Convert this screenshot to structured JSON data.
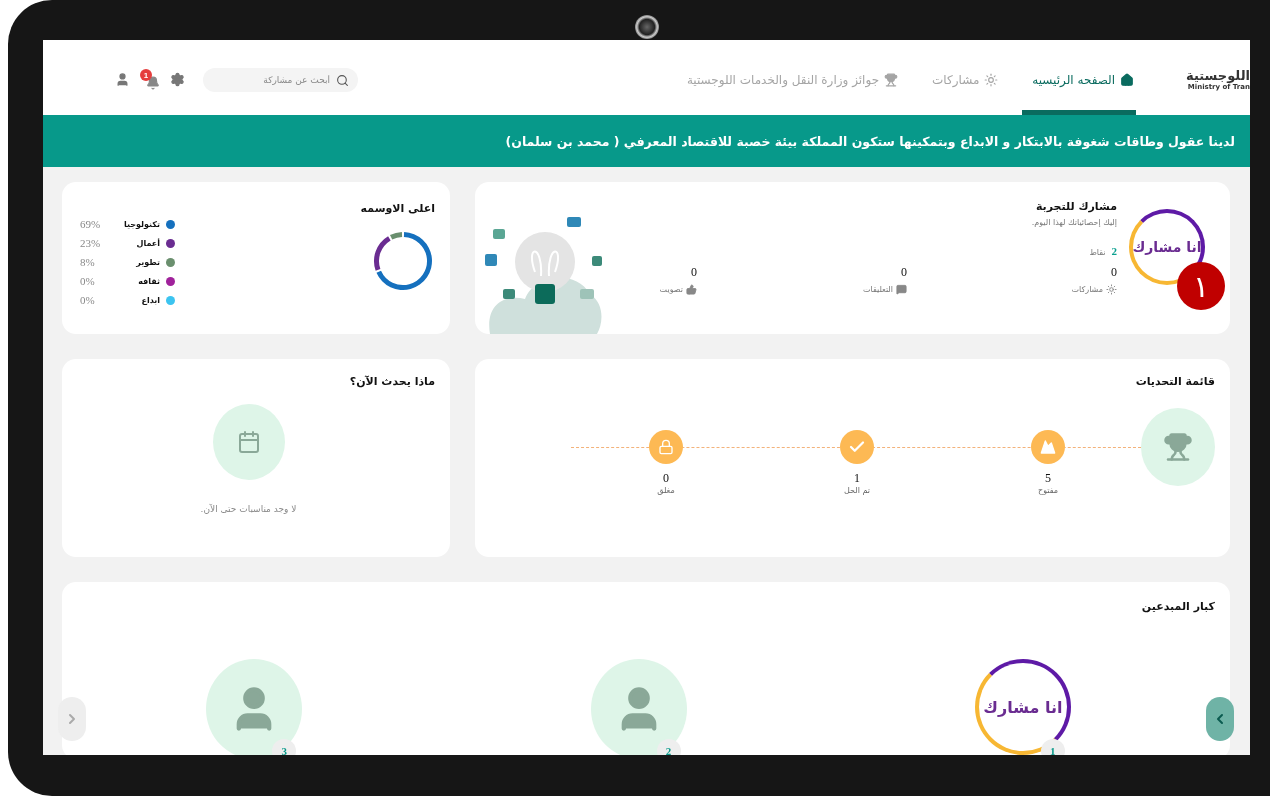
{
  "header": {
    "logo": {
      "title": "اللوجستية",
      "subtitle": "Ministry of Tran"
    },
    "nav": [
      {
        "label": "الصفحه الرئيسيه",
        "selected": true
      },
      {
        "label": "مشاركات",
        "selected": false
      },
      {
        "label": "جوائز وزارة النقل والخدمات اللوجستية",
        "selected": false
      }
    ],
    "search": {
      "placeholder": "أبحث عن مشاركة"
    },
    "notifications": {
      "count": "1"
    }
  },
  "banner": "لدينا عقول وطاقات شغوفة بالابتكار و الابداع وبتمكينها ستكون المملكة بيئة خصبة للاقتصاد المعرفي ( محمد بن سلمان)",
  "profile": {
    "name": "مشارك للتجربة",
    "subtitle": "إليك إحصائياتك لهذا اليوم.",
    "avatar_text": "انا مشارك",
    "badge": "١",
    "points": {
      "value": "2",
      "label": "نقاط"
    },
    "stats": [
      {
        "value": "0",
        "label": "مشاركات"
      },
      {
        "value": "0",
        "label": "التعليقات"
      },
      {
        "value": "0",
        "label": "تصويت"
      }
    ]
  },
  "top_badges": {
    "title": "اعلى الاوسمه",
    "legend": [
      {
        "percent": "69%",
        "color": "#1570be"
      },
      {
        "percent": "23%",
        "color": "#6a2c91"
      },
      {
        "percent": "8%",
        "color": "#6a8f6e"
      },
      {
        "percent": "0%",
        "color": "#a0229b"
      },
      {
        "percent": "0%",
        "color": "#3cc4f0"
      }
    ],
    "chart_data": {
      "type": "donut",
      "categories": [
        "تكنولوجيا",
        "أعمال",
        "تطوير",
        "ثقافه",
        "ابداع"
      ],
      "values": [
        69,
        23,
        8,
        0,
        0
      ]
    }
  },
  "challenges": {
    "title": "قائمة التحديات",
    "items": [
      {
        "kind": "open",
        "count": "5",
        "label": "مفتوح"
      },
      {
        "kind": "solved",
        "count": "1",
        "label": "تم الحل"
      },
      {
        "kind": "closed",
        "count": "0",
        "label": "مغلق"
      }
    ]
  },
  "events": {
    "title": "ماذا يحدث الآن؟",
    "empty": "لا وجد مناسبات حتى الآن."
  },
  "creators": {
    "title": "كبار المبدعين",
    "items": [
      {
        "rank": "1",
        "kind": "logo",
        "avatar_text": "انا مشارك"
      },
      {
        "rank": "2",
        "kind": "generic"
      },
      {
        "rank": "3",
        "kind": "generic"
      }
    ]
  }
}
